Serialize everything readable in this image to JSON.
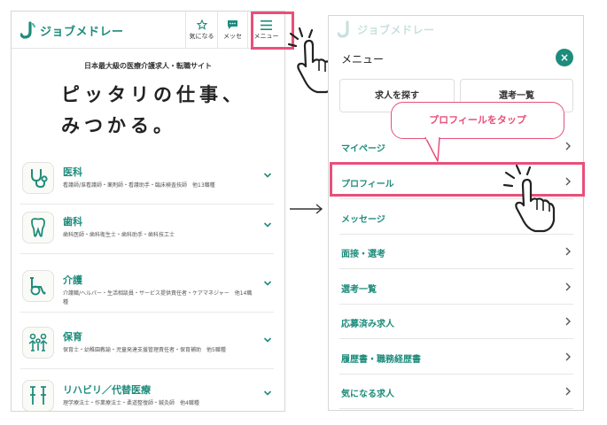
{
  "left": {
    "logo": "ジョブメドレー",
    "header": {
      "favorites_label": "気になる",
      "messages_label": "メッセ",
      "menu_label": "メニュー"
    },
    "tagline": "日本最大級の医療介護求人・転職サイト",
    "hero_line1": "ピッタリの仕事、",
    "hero_line2": "みつかる。",
    "categories": [
      {
        "title": "医科",
        "sub": "看護師/准看護師・薬剤師・看護助手・臨床検査技師　他13職種",
        "icon": "stethoscope-icon"
      },
      {
        "title": "歯科",
        "sub": "歯科医師・歯科衛生士・歯科助手・歯科技工士",
        "icon": "tooth-icon"
      },
      {
        "title": "介護",
        "sub": "介護職/ヘルパー・生活相談員・サービス提供責任者・ケアマネジャー　他14職種",
        "icon": "wheelchair-icon"
      },
      {
        "title": "保育",
        "sub": "保育士・幼稚園教諭・児童発達支援管理責任者・保育補助　他5職種",
        "icon": "children-icon"
      },
      {
        "title": "リハビリ／代替医療",
        "sub": "理学療法士・作業療法士・柔道整復師・鍼灸師　他4職種",
        "icon": "crutches-icon"
      }
    ]
  },
  "right": {
    "logo": "ジョブメドレー",
    "menu_title": "メニュー",
    "quick_buttons": [
      "求人を探す",
      "選考一覧"
    ],
    "tooltip": "プロフィールをタップ",
    "items": [
      "マイページ",
      "プロフィール",
      "メッセージ",
      "面接・選考",
      "選考一覧",
      "応募済み求人",
      "履歴書・職務経歴書",
      "気になる求人"
    ]
  },
  "colors": {
    "brand": "#1e8c7c",
    "highlight": "#e8507a"
  }
}
